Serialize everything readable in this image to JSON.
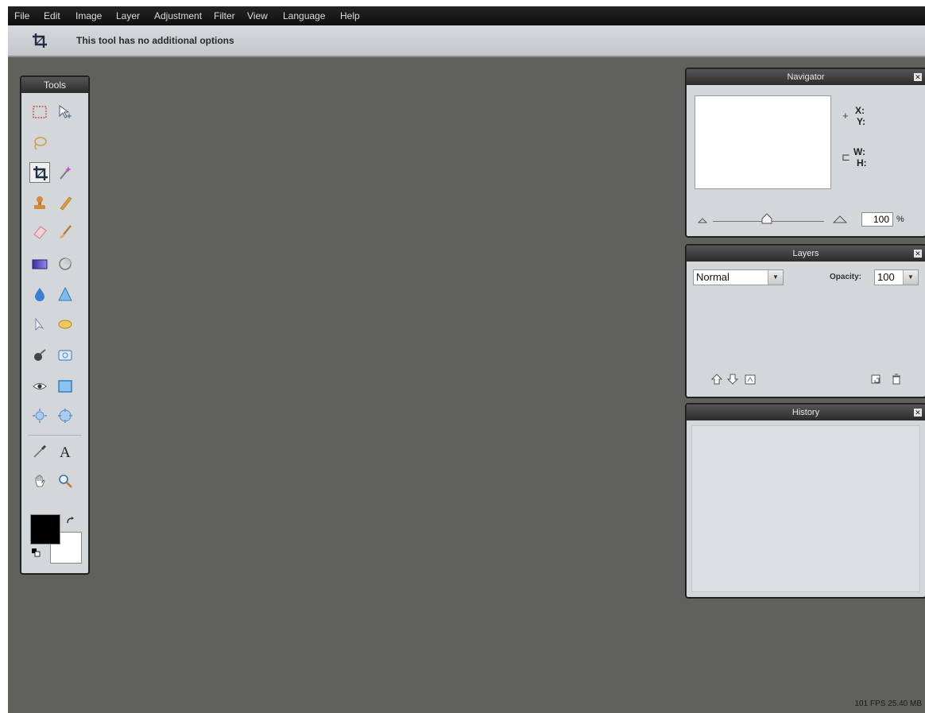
{
  "menu": [
    "File",
    "Edit",
    "Image",
    "Layer",
    "Adjustment",
    "Filter",
    "View",
    "Language",
    "Help"
  ],
  "options_bar": {
    "message": "This tool has no additional options",
    "active_tool_icon": "crop-icon"
  },
  "tools_panel": {
    "title": "Tools",
    "tools": [
      "marquee-select",
      "move",
      "lasso",
      "crop",
      "magic-wand",
      "clone-stamp",
      "pencil",
      "eraser",
      "brush",
      "gradient",
      "color-replace",
      "blur",
      "sharpen",
      "smudge",
      "sponge",
      "burn",
      "dodge",
      "red-eye",
      "shape",
      "bloat",
      "pinch",
      "color-picker",
      "type",
      "hand",
      "zoom"
    ],
    "active_tool": "crop",
    "foreground_color": "#000000",
    "background_color": "#ffffff"
  },
  "navigator": {
    "title": "Navigator",
    "x_label": "X:",
    "y_label": "Y:",
    "w_label": "W:",
    "h_label": "H:",
    "zoom_value": "100",
    "zoom_unit": "%"
  },
  "layers": {
    "title": "Layers",
    "blend_mode": "Normal",
    "opacity_label": "Opacity:",
    "opacity_value": "100"
  },
  "history": {
    "title": "History"
  },
  "status": "101 FPS 25.40 MB"
}
